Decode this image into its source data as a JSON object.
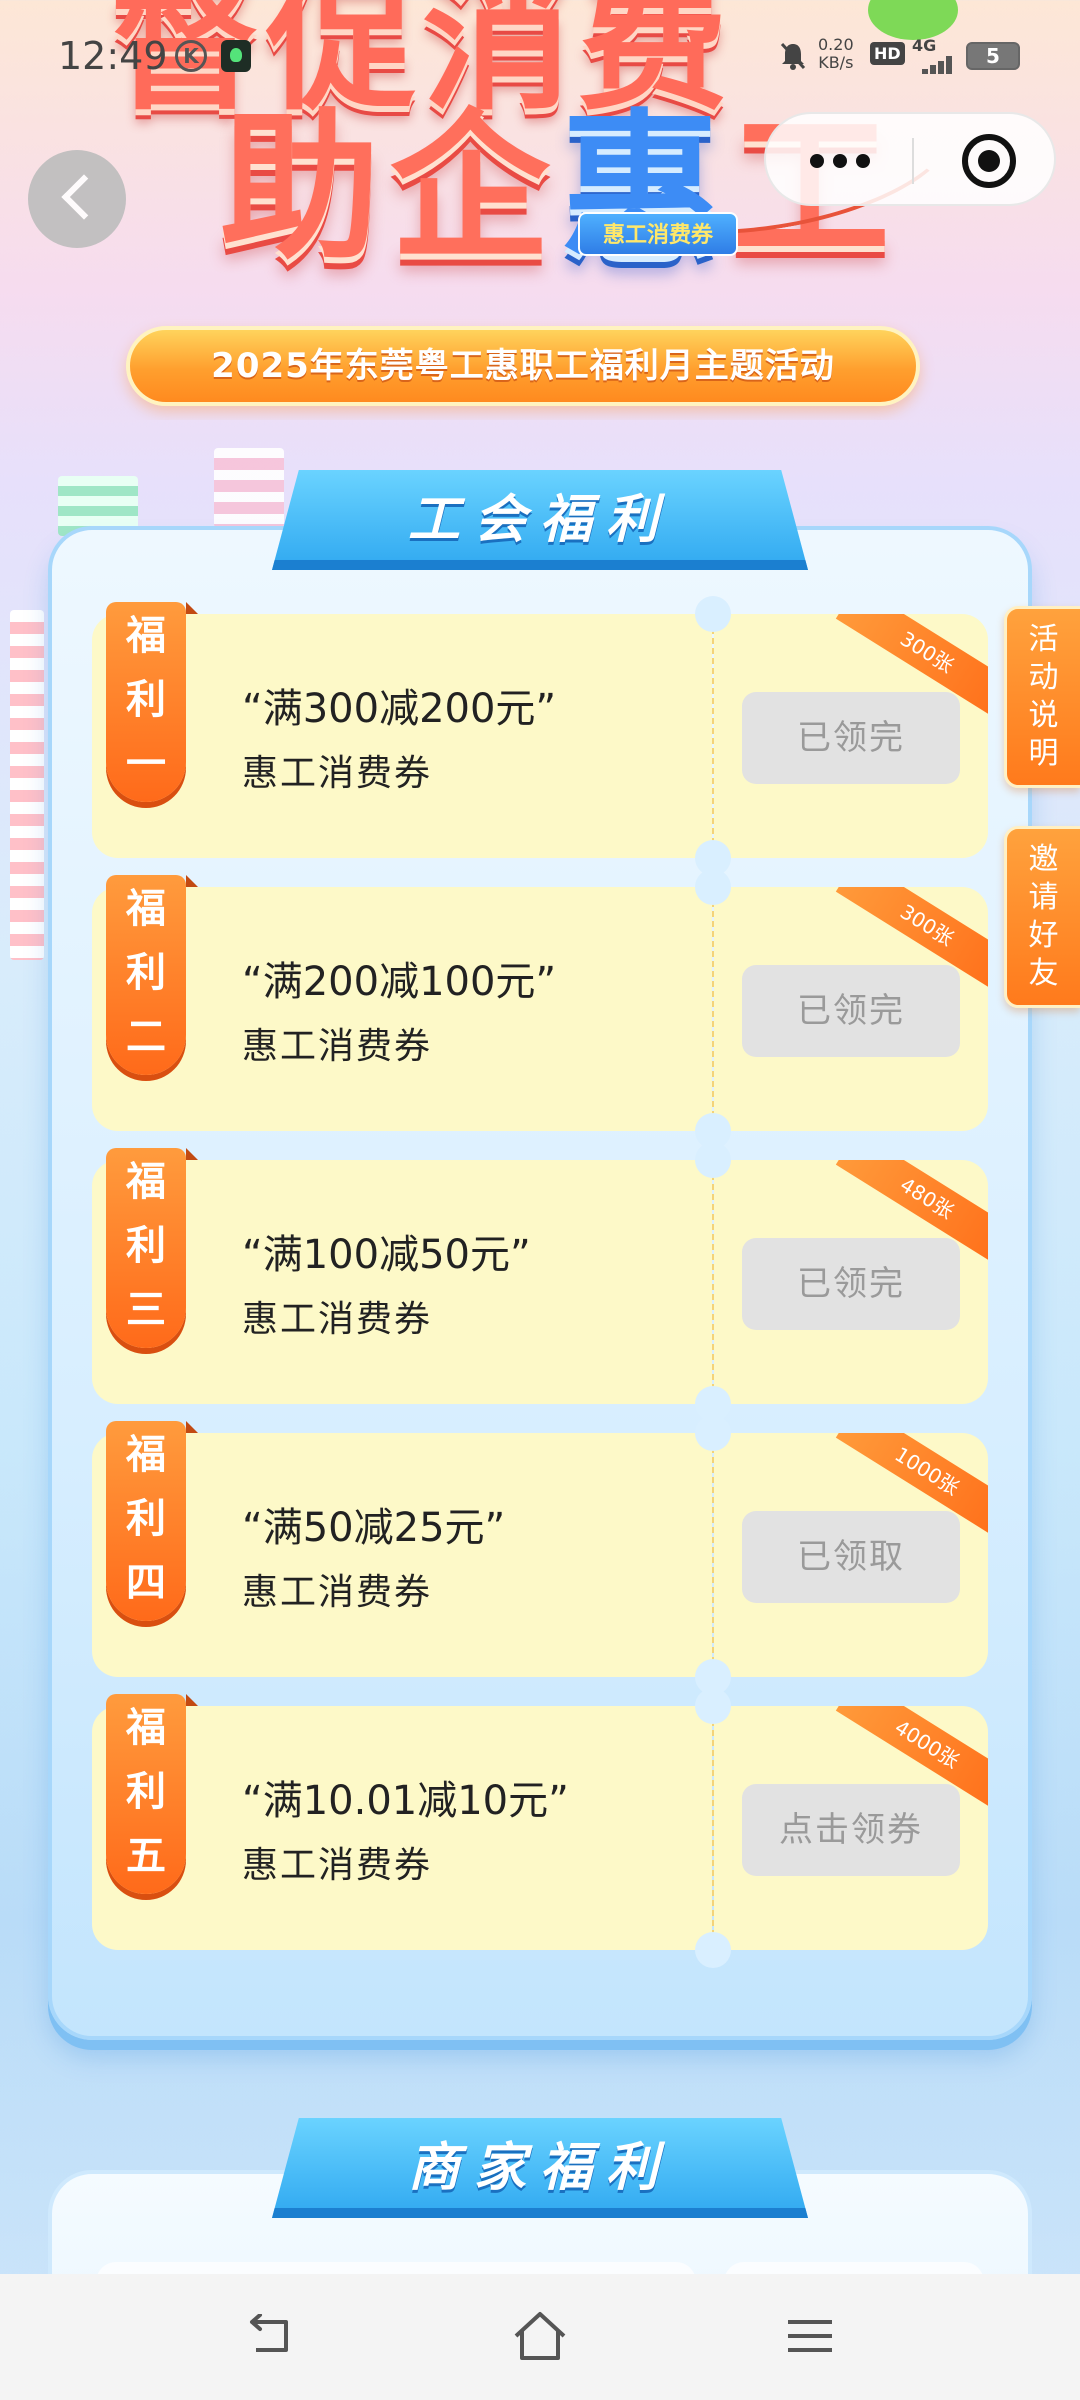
{
  "status_bar": {
    "time": "12:49",
    "k_icon": "K",
    "speed_value": "0.20",
    "speed_unit": "KB/s",
    "hd": "HD",
    "network": "4G",
    "battery": "5"
  },
  "hero": {
    "title_top": "督促消费",
    "title_main_left": "助企",
    "title_main_blue": "惠",
    "title_main_right": "工",
    "badge": "惠工消费券",
    "subtitle": "2025年东莞粤工惠职工福利月主题活动"
  },
  "section_union": {
    "title": "工会福利"
  },
  "coupons": [
    {
      "ribbon": [
        "福",
        "利",
        "一"
      ],
      "amount": "“满300减200元”",
      "type": "惠工消费券",
      "qty": "300张",
      "action": "已领完"
    },
    {
      "ribbon": [
        "福",
        "利",
        "二"
      ],
      "amount": "“满200减100元”",
      "type": "惠工消费券",
      "qty": "300张",
      "action": "已领完"
    },
    {
      "ribbon": [
        "福",
        "利",
        "三"
      ],
      "amount": "“满100减50元”",
      "type": "惠工消费券",
      "qty": "480张",
      "action": "已领完"
    },
    {
      "ribbon": [
        "福",
        "利",
        "四"
      ],
      "amount": "“满50减25元”",
      "type": "惠工消费券",
      "qty": "1000张",
      "action": "已领取"
    },
    {
      "ribbon": [
        "福",
        "利",
        "五"
      ],
      "amount": "“满10.01减10元”",
      "type": "惠工消费券",
      "qty": "4000张",
      "action": "点击领券"
    }
  ],
  "side_tabs": {
    "rules": [
      "活",
      "动",
      "说",
      "明"
    ],
    "invite": [
      "邀",
      "请",
      "好",
      "友"
    ]
  },
  "section_merchant": {
    "title": "商家福利"
  },
  "icons": {
    "back": "chevron-left-icon",
    "more": "more-dots-icon",
    "close": "target-circle-icon",
    "nav_back": "return-arrow-icon",
    "nav_home": "home-icon",
    "nav_menu": "hamburger-menu-icon"
  },
  "colors": {
    "accent_orange": "#ff7a1c",
    "accent_blue": "#2fa8f0",
    "coupon_bg": "#fdf9c8",
    "disabled_button": "#e2e2e2"
  }
}
